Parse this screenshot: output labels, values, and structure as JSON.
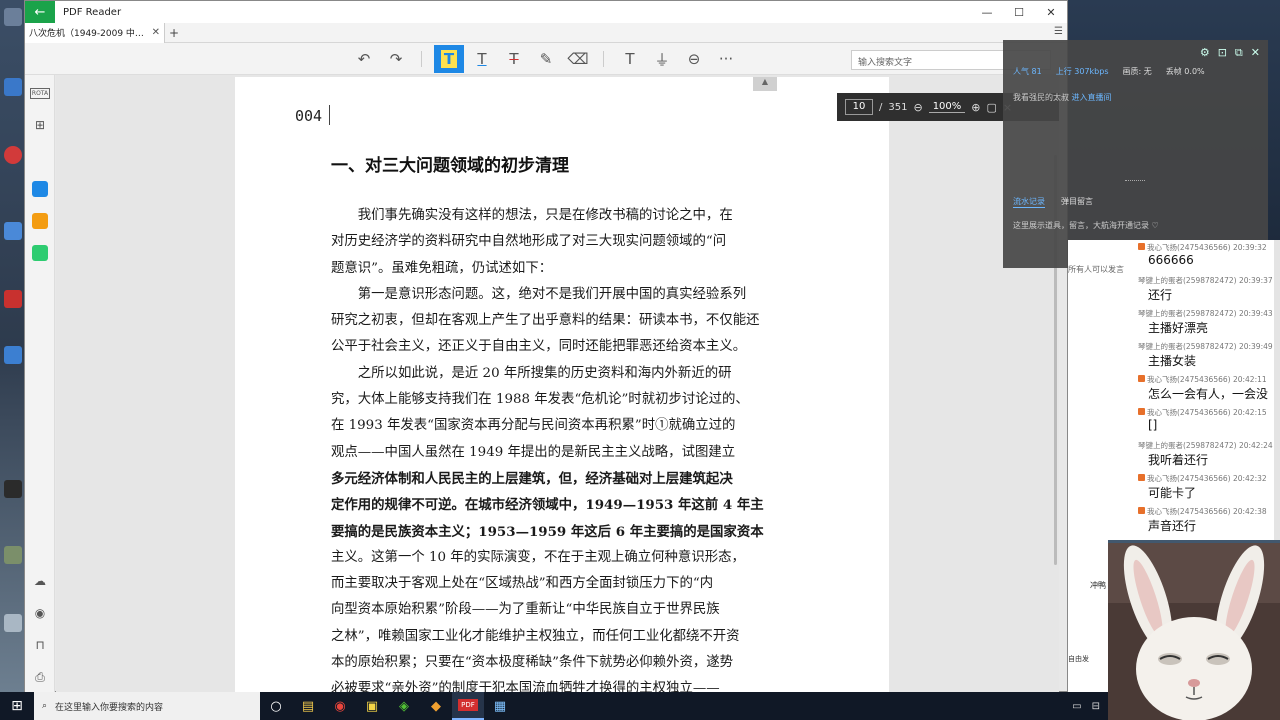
{
  "window": {
    "app_title": "PDF Reader",
    "back_icon": "←",
    "minimize": "—",
    "maximize": "☐",
    "close": "✕"
  },
  "tabs": {
    "doc_tab_label": "八次危机（1949-2009 中国的真...",
    "close_icon": "✕",
    "new_tab_icon": "+",
    "menu_icon": "☰"
  },
  "toolbar": {
    "undo": "↶",
    "redo": "↷",
    "highlight": "T",
    "text": "T",
    "strikethrough": "T",
    "pen": "✎",
    "eraser": "⌫",
    "typewriter": "T",
    "stamp": "⏚",
    "link": "⊖",
    "more": "···",
    "search_placeholder": "输入搜索文字"
  },
  "left_rail": {
    "thumb_label": "ROTA",
    "grid": "⊞",
    "cloud": "☁",
    "eye": "◉",
    "bookmark": "⊓",
    "print": "⎙"
  },
  "page": {
    "page_number": "004",
    "heading": "一、对三大问题领域的初步清理",
    "lines": [
      {
        "text": "　　我们事先确实没有这样的想法，只是在修改书稿的讨论之中，在",
        "bold": false
      },
      {
        "text": "对历史经济学的资料研究中自然地形成了对三大现实问题领域的“问",
        "bold": false
      },
      {
        "text": "题意识”。虽难免粗疏，仍试述如下：",
        "bold": false
      },
      {
        "text": "　　第一是意识形态问题。这，绝对不是我们开展中国的真实经验系列",
        "bold": false
      },
      {
        "text": "研究之初衷，但却在客观上产生了出乎意料的结果：研读本书，不仅能还",
        "bold": false
      },
      {
        "text": "公平于社会主义，还正义于自由主义，同时还能把罪恶还给资本主义。",
        "bold": false
      },
      {
        "text": "　　之所以如此说，是近 20 年所搜集的历史资料和海内外新近的研",
        "bold": false
      },
      {
        "text": "究，大体上能够支持我们在 1988 年发表“危机论”时就初步讨论过的、",
        "bold": false
      },
      {
        "text": "在 1993 年发表“国家资本再分配与民间资本再积累”时①就确立过的",
        "bold": false
      },
      {
        "text": "观点——中国人虽然在 1949 年提出的是新民主主义战略，试图建立",
        "bold": false
      },
      {
        "text": "多元经济体制和人民民主的上层建筑，但，经济基础对上层建筑起决",
        "bold": true
      },
      {
        "text": "定作用的规律不可逆。在城市经济领域中，1949—1953 年这前 4 年主",
        "bold": true
      },
      {
        "text": "要搞的是民族资本主义；1953—1959 年这后 6 年主要搞的是国家资本",
        "bold": true
      },
      {
        "text": "主义。这第一个 10 年的实际演变，不在于主观上确立何种意识形态，",
        "bold": false
      },
      {
        "text": "而主要取决于客观上处在“区域热战”和西方全面封锁压力下的“内",
        "bold": false
      },
      {
        "text": "向型资本原始积累”阶段——为了重新让“中华民族自立于世界民族",
        "bold": false
      },
      {
        "text": "之林”，唯赖国家工业化才能维护主权独立，而任何工业化都绕不开资",
        "bold": false
      },
      {
        "text": "本的原始积累；只要在“资本极度稀缺”条件下就势必仰赖外资，遂势",
        "bold": false
      },
      {
        "text": "必被要求“亲外资”的制度干犯本国流血牺牲才换得的主权独立——",
        "bold": false
      }
    ]
  },
  "page_nav": {
    "current_page": "10",
    "separator": "/",
    "total_pages": "351",
    "zoom_out_icon": "⊖",
    "zoom": "100%",
    "zoom_in_icon": "⊕",
    "fit_icon": "▢",
    "close_icon": "×"
  },
  "live_panel": {
    "popularity": "人气 81",
    "upload": "上行 307kbps",
    "quality": "画质: 无",
    "packet_loss": "丢帧 0.0%",
    "line2_prefix": "我看强民的太叔",
    "line2_link": "进入直播间",
    "tab1": "流水记录",
    "tab2": "弹目留言",
    "note": "这里展示道具，留言，大航海开通记录 ♡",
    "icons": [
      "⚙",
      "⊡",
      "⧉",
      "✕"
    ]
  },
  "chat": {
    "hint": "所有人可以发言",
    "items": [
      {
        "meta": "我心飞扬(2475436566) 20:39:32",
        "msg": "666666",
        "badge": true
      },
      {
        "meta": "琴键上的蛋者(2598782472) 20:39:37",
        "msg": "还行",
        "badge": false
      },
      {
        "meta": "琴键上的蛋者(2598782472) 20:39:43",
        "msg": "主播好漂亮",
        "badge": false
      },
      {
        "meta": "琴键上的蛋者(2598782472) 20:39:49",
        "msg": "主播女装",
        "badge": false
      },
      {
        "meta": "我心飞扬(2475436566) 20:42:11",
        "msg": "怎么一会有人，一会没",
        "badge": true
      },
      {
        "meta": "我心飞扬(2475436566) 20:42:15",
        "msg": "[]",
        "badge": true
      },
      {
        "meta": "琴键上的蛋者(2598782472) 20:42:24",
        "msg": "我听着还行",
        "badge": false
      },
      {
        "meta": "我心飞扬(2475436566) 20:42:32",
        "msg": "可能卡了",
        "badge": true
      },
      {
        "meta": "我心飞扬(2475436566) 20:42:38",
        "msg": "声音还行",
        "badge": true
      }
    ],
    "bottom_label": "冲鸭",
    "follow": "自由发"
  },
  "taskbar": {
    "start_icon": "⊞",
    "search_icon": "⌕",
    "search_placeholder": "在这里输入你要搜索的内容",
    "apps": [
      "○",
      "▤",
      "◉",
      "▣",
      "◈",
      "◆",
      "PDF",
      "▦"
    ],
    "tray": [
      "▭",
      "⊟"
    ]
  },
  "colors": {
    "accent": "#1e88e5",
    "back_button": "#1aa34a",
    "live_link": "#6cb7ff",
    "chat_badge": "#e7702b"
  }
}
